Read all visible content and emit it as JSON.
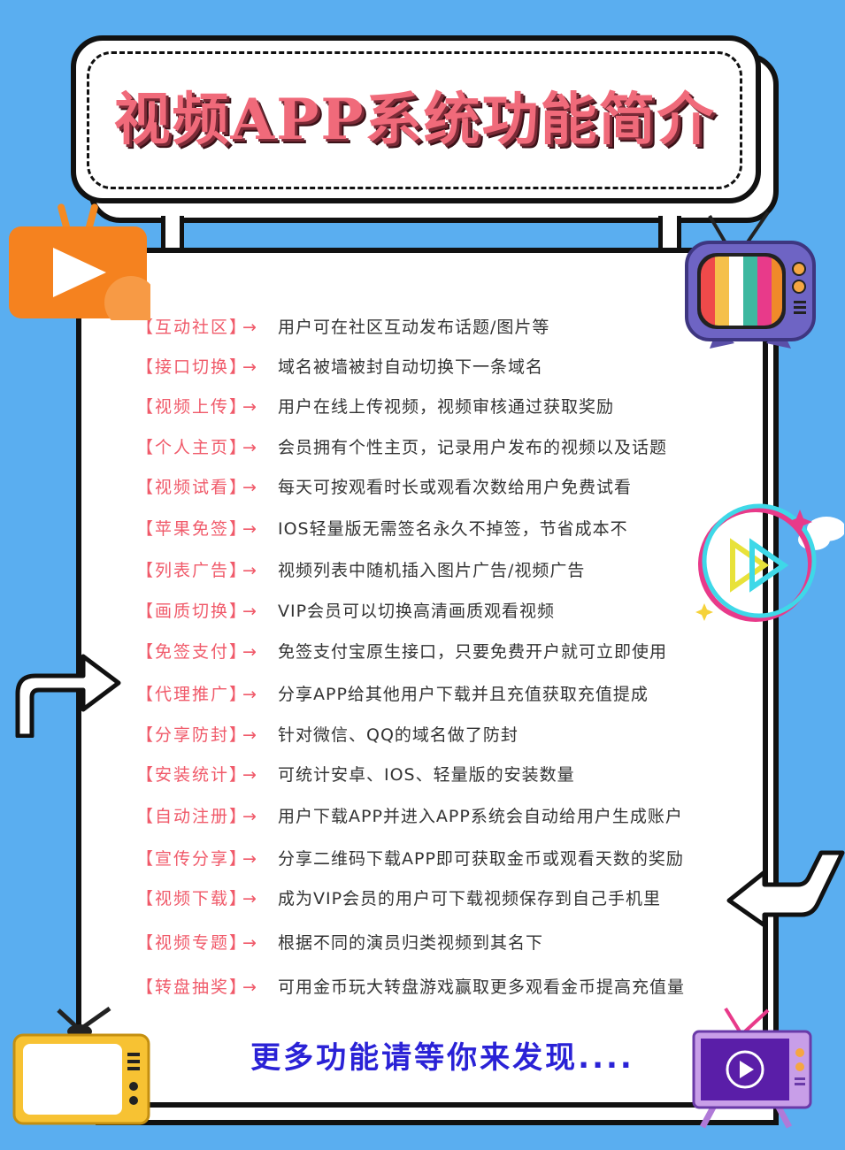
{
  "header": {
    "title": "视频APP系统功能简介"
  },
  "features": [
    {
      "tag": "【互动社区】",
      "arrow": "→",
      "desc": "用户可在社区互动发布话题/图片等"
    },
    {
      "tag": "【接口切换】",
      "arrow": "→",
      "desc": "域名被墙被封自动切换下一条域名"
    },
    {
      "tag": "【视频上传】",
      "arrow": "→",
      "desc": "用户在线上传视频，视频审核通过获取奖励"
    },
    {
      "tag": "【个人主页】",
      "arrow": "→",
      "desc": "会员拥有个性主页，记录用户发布的视频以及话题"
    },
    {
      "tag": "【视频试看】",
      "arrow": "→",
      "desc": "每天可按观看时长或观看次数给用户免费试看"
    },
    {
      "tag": "【苹果免签】",
      "arrow": "→",
      "desc": "IOS轻量版无需签名永久不掉签，节省成本不"
    },
    {
      "tag": "【列表广告】",
      "arrow": "→",
      "desc": "视频列表中随机插入图片广告/视频广告"
    },
    {
      "tag": "【画质切换】",
      "arrow": "→",
      "desc": "VIP会员可以切换高清画质观看视频"
    },
    {
      "tag": "【免签支付】",
      "arrow": "→",
      "desc": "免签支付宝原生接口，只要免费开户就可立即使用"
    },
    {
      "tag": "【代理推广】",
      "arrow": "→",
      "desc": "分享APP给其他用户下载并且充值获取充值提成"
    },
    {
      "tag": "【分享防封】",
      "arrow": "→",
      "desc": "针对微信、QQ的域名做了防封"
    },
    {
      "tag": "【安装统计】",
      "arrow": "→",
      "desc": "可统计安卓、IOS、轻量版的安装数量"
    },
    {
      "tag": "【自动注册】",
      "arrow": "→",
      "desc": "用户下载APP并进入APP系统会自动给用户生成账户"
    },
    {
      "tag": "【宣传分享】",
      "arrow": "→",
      "desc": "分享二维码下载APP即可获取金币或观看天数的奖励"
    },
    {
      "tag": "【视频下载】",
      "arrow": "→",
      "desc": "成为VIP会员的用户可下载视频保存到自己手机里"
    },
    {
      "tag": "【视频专题】",
      "arrow": "→",
      "desc": "根据不同的演员归类视频到其名下"
    },
    {
      "tag": "【转盘抽奖】",
      "arrow": "→",
      "desc": "可用金币玩大转盘游戏赢取更多观看金币提高充值量"
    }
  ],
  "footer": {
    "text": "更多功能请等你来发现...."
  },
  "colors": {
    "background": "#5aaef0",
    "title": "#f06a7a",
    "tag": "#f05a6a",
    "footer": "#2a22d6"
  },
  "icons": [
    "play-badge-icon",
    "tv-color-bars-icon",
    "play-circle-icon",
    "tv-blank-icon",
    "tv-video-icon",
    "bend-arrow-icon",
    "return-arrow-icon"
  ]
}
